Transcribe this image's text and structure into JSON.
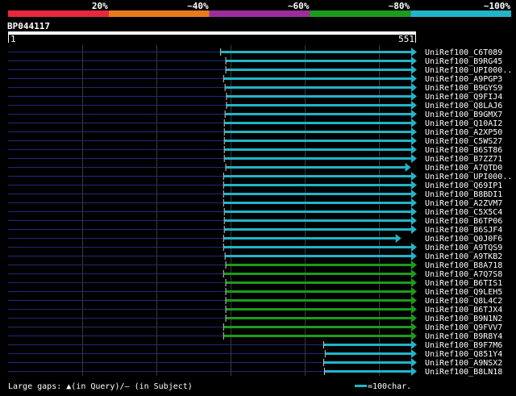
{
  "chart_data": {
    "type": "alignment-overview",
    "title": "BP044117",
    "query_length": 551,
    "ruler": {
      "start_label": "1",
      "end_label": "551"
    },
    "identity_legend": [
      {
        "label": "20%",
        "color": "#e8283c"
      },
      {
        "label": "~40%",
        "color": "#e97a1c"
      },
      {
        "label": "~60%",
        "color": "#9b2e9b"
      },
      {
        "label": "~80%",
        "color": "#1c9c1c"
      },
      {
        "label": "~100%",
        "color": "#22b4c8"
      }
    ],
    "hits": [
      {
        "name": "UniRef100_C6T089",
        "start": 287,
        "end": 551,
        "identity_band": "~100%",
        "color": "#22b4c8",
        "arrow": true
      },
      {
        "name": "UniRef100_B9RG45",
        "start": 294,
        "end": 551,
        "identity_band": "~100%",
        "color": "#22b4c8",
        "arrow": true
      },
      {
        "name": "UniRef100_UPI000..",
        "start": 294,
        "end": 551,
        "identity_band": "~100%",
        "color": "#22b4c8",
        "arrow": true
      },
      {
        "name": "UniRef100_A9PGP3",
        "start": 291,
        "end": 551,
        "identity_band": "~100%",
        "color": "#22b4c8",
        "arrow": true
      },
      {
        "name": "UniRef100_B9GYS9",
        "start": 293,
        "end": 551,
        "identity_band": "~100%",
        "color": "#22b4c8",
        "arrow": true
      },
      {
        "name": "UniRef100_Q9FIJ4",
        "start": 295,
        "end": 551,
        "identity_band": "~100%",
        "color": "#22b4c8",
        "arrow": true
      },
      {
        "name": "UniRef100_Q8LAJ6",
        "start": 295,
        "end": 551,
        "identity_band": "~100%",
        "color": "#22b4c8",
        "arrow": true
      },
      {
        "name": "UniRef100_B9GMX7",
        "start": 293,
        "end": 551,
        "identity_band": "~100%",
        "color": "#22b4c8",
        "arrow": true
      },
      {
        "name": "UniRef100_Q10AI2",
        "start": 292,
        "end": 551,
        "identity_band": "~100%",
        "color": "#22b4c8",
        "arrow": true
      },
      {
        "name": "UniRef100_A2XP50",
        "start": 292,
        "end": 551,
        "identity_band": "~100%",
        "color": "#22b4c8",
        "arrow": true
      },
      {
        "name": "UniRef100_C5WS27",
        "start": 292,
        "end": 551,
        "identity_band": "~100%",
        "color": "#22b4c8",
        "arrow": true
      },
      {
        "name": "UniRef100_B6ST86",
        "start": 292,
        "end": 551,
        "identity_band": "~100%",
        "color": "#22b4c8",
        "arrow": true
      },
      {
        "name": "UniRef100_B7ZZ71",
        "start": 292,
        "end": 551,
        "identity_band": "~100%",
        "color": "#22b4c8",
        "arrow": true
      },
      {
        "name": "UniRef100_A7QTD0",
        "start": 294,
        "end": 543,
        "identity_band": "~100%",
        "color": "#22b4c8",
        "arrow": true
      },
      {
        "name": "UniRef100_UPI000..",
        "start": 291,
        "end": 551,
        "identity_band": "~100%",
        "color": "#22b4c8",
        "arrow": true
      },
      {
        "name": "UniRef100_Q69IP1",
        "start": 291,
        "end": 551,
        "identity_band": "~100%",
        "color": "#22b4c8",
        "arrow": true
      },
      {
        "name": "UniRef100_B8BDI1",
        "start": 291,
        "end": 551,
        "identity_band": "~100%",
        "color": "#22b4c8",
        "arrow": true
      },
      {
        "name": "UniRef100_A2ZVM7",
        "start": 291,
        "end": 551,
        "identity_band": "~100%",
        "color": "#22b4c8",
        "arrow": true
      },
      {
        "name": "UniRef100_C5X5C4",
        "start": 292,
        "end": 551,
        "identity_band": "~100%",
        "color": "#22b4c8",
        "arrow": true
      },
      {
        "name": "UniRef100_B6TP06",
        "start": 292,
        "end": 551,
        "identity_band": "~100%",
        "color": "#22b4c8",
        "arrow": true
      },
      {
        "name": "UniRef100_B6SJF4",
        "start": 292,
        "end": 551,
        "identity_band": "~100%",
        "color": "#22b4c8",
        "arrow": true
      },
      {
        "name": "UniRef100_Q0J0F6",
        "start": 291,
        "end": 530,
        "identity_band": "~100%",
        "color": "#22b4c8",
        "arrow": true
      },
      {
        "name": "UniRef100_A9TQS9",
        "start": 291,
        "end": 551,
        "identity_band": "~100%",
        "color": "#22b4c8",
        "arrow": true
      },
      {
        "name": "UniRef100_A9TKB2",
        "start": 293,
        "end": 551,
        "identity_band": "~100%",
        "color": "#22b4c8",
        "arrow": true
      },
      {
        "name": "UniRef100_B8A718",
        "start": 294,
        "end": 551,
        "identity_band": "~80%",
        "color": "#1c9c1c",
        "arrow": true
      },
      {
        "name": "UniRef100_A7Q7S8",
        "start": 291,
        "end": 551,
        "identity_band": "~80%",
        "color": "#1c9c1c",
        "arrow": true
      },
      {
        "name": "UniRef100_B6TIS1",
        "start": 294,
        "end": 551,
        "identity_band": "~80%",
        "color": "#1c9c1c",
        "arrow": true
      },
      {
        "name": "UniRef100_Q9LEH5",
        "start": 294,
        "end": 551,
        "identity_band": "~80%",
        "color": "#1c9c1c",
        "arrow": true
      },
      {
        "name": "UniRef100_Q8L4C2",
        "start": 294,
        "end": 551,
        "identity_band": "~80%",
        "color": "#1c9c1c",
        "arrow": true
      },
      {
        "name": "UniRef100_B6TJX4",
        "start": 294,
        "end": 551,
        "identity_band": "~80%",
        "color": "#1c9c1c",
        "arrow": true
      },
      {
        "name": "UniRef100_B9N1N2",
        "start": 294,
        "end": 551,
        "identity_band": "~80%",
        "color": "#1c9c1c",
        "arrow": true
      },
      {
        "name": "UniRef100_Q9FVV7",
        "start": 291,
        "end": 551,
        "identity_band": "~80%",
        "color": "#1c9c1c",
        "arrow": true
      },
      {
        "name": "UniRef100_B9R8Y4",
        "start": 291,
        "end": 551,
        "identity_band": "~80%",
        "color": "#1c9c1c",
        "arrow": true
      },
      {
        "name": "UniRef100_B9F7M6",
        "start": 426,
        "end": 551,
        "identity_band": "~100%",
        "color": "#22b4c8",
        "arrow": true
      },
      {
        "name": "UniRef100_Q851Y4",
        "start": 428,
        "end": 551,
        "identity_band": "~100%",
        "color": "#22b4c8",
        "arrow": true
      },
      {
        "name": "UniRef100_A9NSX2",
        "start": 426,
        "end": 551,
        "identity_band": "~100%",
        "color": "#22b4c8",
        "arrow": true
      },
      {
        "name": "UniRef100_B8LN18",
        "start": 427,
        "end": 551,
        "identity_band": "~100%",
        "color": "#22b4c8",
        "arrow": true
      }
    ],
    "grid": true,
    "footer": {
      "gaps_label": "Large gaps: ",
      "query_marker": "▲",
      "in_query": "(in Query)/",
      "subject_marker": "–",
      "in_subject": " (in Subject)",
      "scale_label": "=100char."
    }
  }
}
